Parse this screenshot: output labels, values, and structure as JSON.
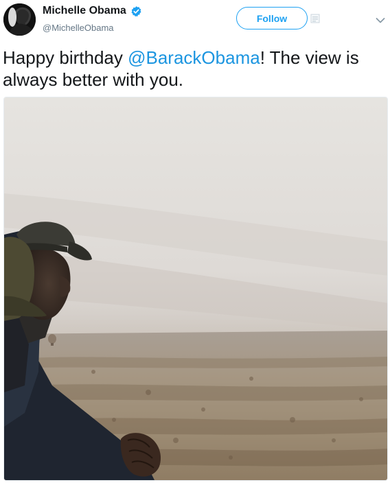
{
  "tweet": {
    "author": {
      "display_name": "Michelle Obama",
      "screen_name": "@MichelleObama",
      "verified": true,
      "avatar_icon": "profile-avatar"
    },
    "follow_label": "Follow",
    "text_before": "Happy birthday ",
    "mention": "@BarackObama",
    "text_after": "! The view is always better with you.",
    "photo": {
      "description_icon": "landscape-photo"
    }
  },
  "colors": {
    "accent": "#1da1f2",
    "link": "#1b95e0",
    "text": "#14171a",
    "secondary": "#657786"
  }
}
